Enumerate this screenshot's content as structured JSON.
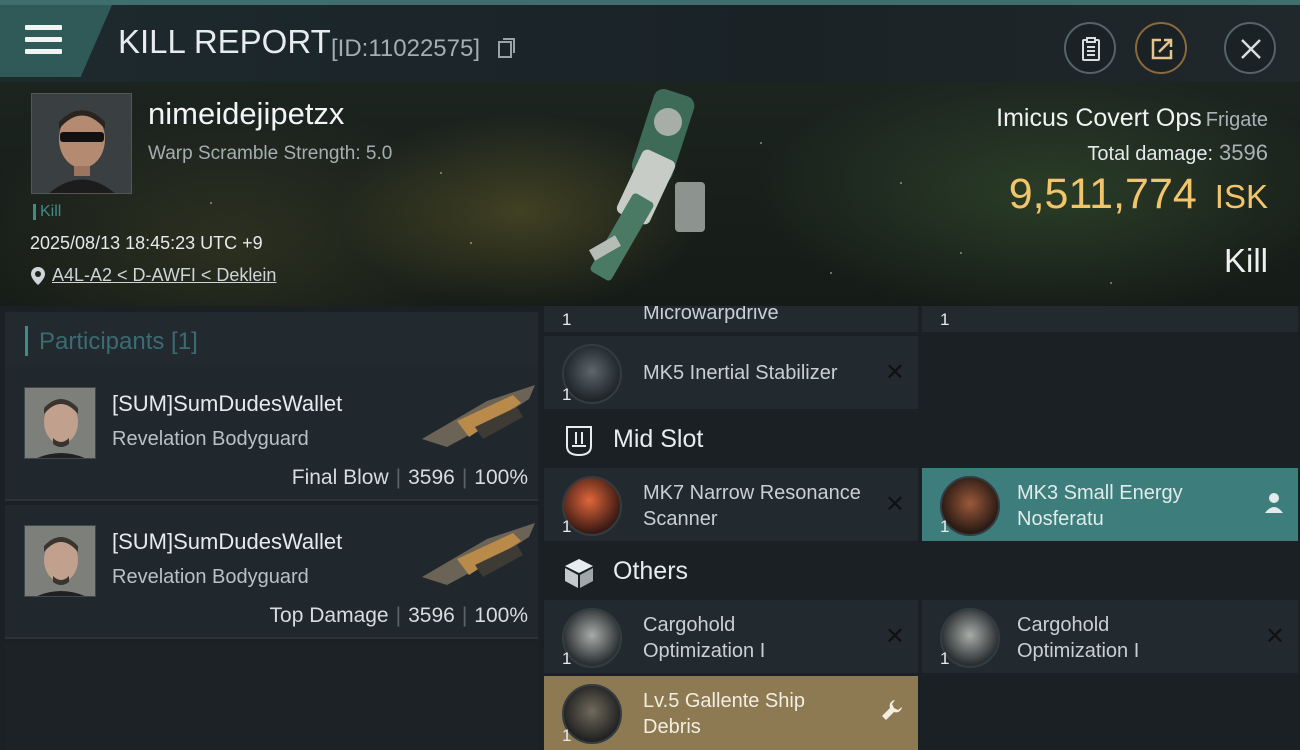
{
  "header": {
    "title": "KILL REPORT",
    "report_id": "[ID:11022575]"
  },
  "victim": {
    "name": "nimeidejipetzx",
    "warp_scramble": "Warp Scramble Strength: 5.0",
    "tag": "Kill",
    "timestamp": "2025/08/13 18:45:23 UTC +9",
    "location": "A4L-A2 < D-AWFI < Deklein",
    "ship_name": "Imicus Covert Ops",
    "ship_class": "Frigate",
    "total_damage_label": "Total damage:",
    "total_damage": "3596",
    "isk_value": "9,511,774",
    "isk_unit": "ISK",
    "result_label": "Kill"
  },
  "participants": {
    "header": "Participants [1]",
    "items": [
      {
        "name": "[SUM]SumDudesWallet",
        "ship": "Revelation Bodyguard",
        "role": "Final Blow",
        "damage": "3596",
        "percent": "100%"
      },
      {
        "name": "[SUM]SumDudesWallet",
        "ship": "Revelation Bodyguard",
        "role": "Top Damage",
        "damage": "3596",
        "percent": "100%"
      }
    ]
  },
  "modules": {
    "partial_top": {
      "name": "Microwarpdrive",
      "qty": "1",
      "qty_right": "1"
    },
    "low": {
      "name": "MK5 Inertial Stabilizer",
      "qty": "1"
    },
    "mid_section": "Mid Slot",
    "mid": [
      {
        "name": "MK7 Narrow Resonance Scanner",
        "qty": "1"
      },
      {
        "name": "MK3 Small Energy Nosferatu",
        "qty": "1"
      }
    ],
    "others_section": "Others",
    "others": [
      {
        "name": "Cargohold Optimization I",
        "qty": "1"
      },
      {
        "name": "Cargohold Optimization I",
        "qty": "1"
      },
      {
        "name": "Lv.5 Gallente Ship Debris",
        "qty": "1"
      }
    ],
    "remove_glyph": "✕"
  },
  "colors": {
    "accent_teal": "#3e8c87",
    "isk_gold": "#f2c56b",
    "dropped_teal": "#3d7d7b",
    "debris_gold": "#8d7a52"
  },
  "icons": [
    "menu-icon",
    "copy-icon",
    "clipboard-icon",
    "share-icon",
    "close-icon",
    "location-pin-icon",
    "mid-slot-icon",
    "cube-icon",
    "person-icon",
    "wrench-icon"
  ]
}
